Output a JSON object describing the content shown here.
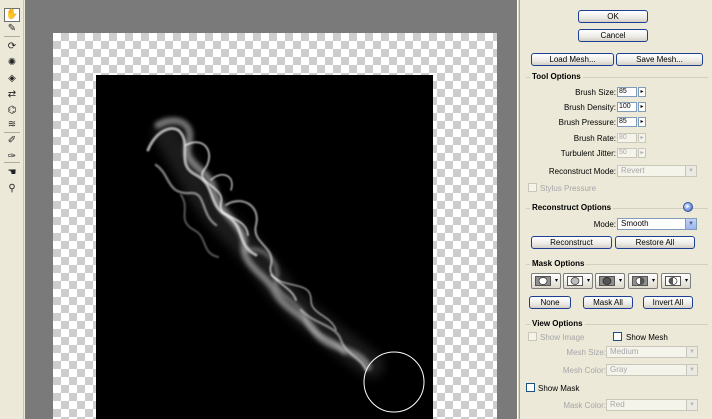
{
  "toolbar": {
    "tools": [
      {
        "name": "forward-warp-tool-icon",
        "glyph": "✋",
        "active": true
      },
      {
        "name": "reconstruct-tool-icon",
        "glyph": "✎",
        "active": false
      },
      {
        "name": "twirl-clockwise-tool-icon",
        "glyph": "⟳",
        "active": false
      },
      {
        "name": "pucker-tool-icon",
        "glyph": "✺",
        "active": false
      },
      {
        "name": "bloat-tool-icon",
        "glyph": "◈",
        "active": false
      },
      {
        "name": "push-left-tool-icon",
        "glyph": "⇄",
        "active": false
      },
      {
        "name": "mirror-tool-icon",
        "glyph": "⌬",
        "active": false
      },
      {
        "name": "turbulence-tool-icon",
        "glyph": "≋",
        "active": false
      },
      {
        "name": "freeze-mask-tool-icon",
        "glyph": "✐",
        "active": false
      },
      {
        "name": "thaw-mask-tool-icon",
        "glyph": "✑",
        "active": false
      },
      {
        "name": "hand-tool-icon",
        "glyph": "☚",
        "active": false
      },
      {
        "name": "zoom-tool-icon",
        "glyph": "⚲",
        "active": false
      }
    ]
  },
  "buttons": {
    "ok": "OK",
    "cancel": "Cancel",
    "load_mesh": "Load Mesh...",
    "save_mesh": "Save Mesh..."
  },
  "tool_options": {
    "title": "Tool Options",
    "brush_size": {
      "label": "Brush Size:",
      "value": "85"
    },
    "brush_density": {
      "label": "Brush Density:",
      "value": "100"
    },
    "brush_pressure": {
      "label": "Brush Pressure:",
      "value": "85"
    },
    "brush_rate": {
      "label": "Brush Rate:",
      "value": "80"
    },
    "turbulent_jitter": {
      "label": "Turbulent Jitter:",
      "value": "50"
    },
    "reconstruct_mode": {
      "label": "Reconstruct Mode:",
      "value": "Revert"
    },
    "stylus_pressure": "Stylus Pressure"
  },
  "reconstruct_options": {
    "title": "Reconstruct Options",
    "mode_label": "Mode:",
    "mode_value": "Smooth",
    "reconstruct_button": "Reconstruct",
    "restore_all_button": "Restore All"
  },
  "mask_options": {
    "title": "Mask Options",
    "none_button": "None",
    "mask_all_button": "Mask All",
    "invert_all_button": "Invert All"
  },
  "view_options": {
    "title": "View Options",
    "show_image": "Show Image",
    "show_mesh": "Show Mesh",
    "mesh_size": {
      "label": "Mesh Size:",
      "value": "Medium"
    },
    "mesh_color": {
      "label": "Mesh Color:",
      "value": "Gray"
    },
    "show_mask": "Show Mask",
    "mask_color": {
      "label": "Mask Color:",
      "value": "Red"
    }
  }
}
